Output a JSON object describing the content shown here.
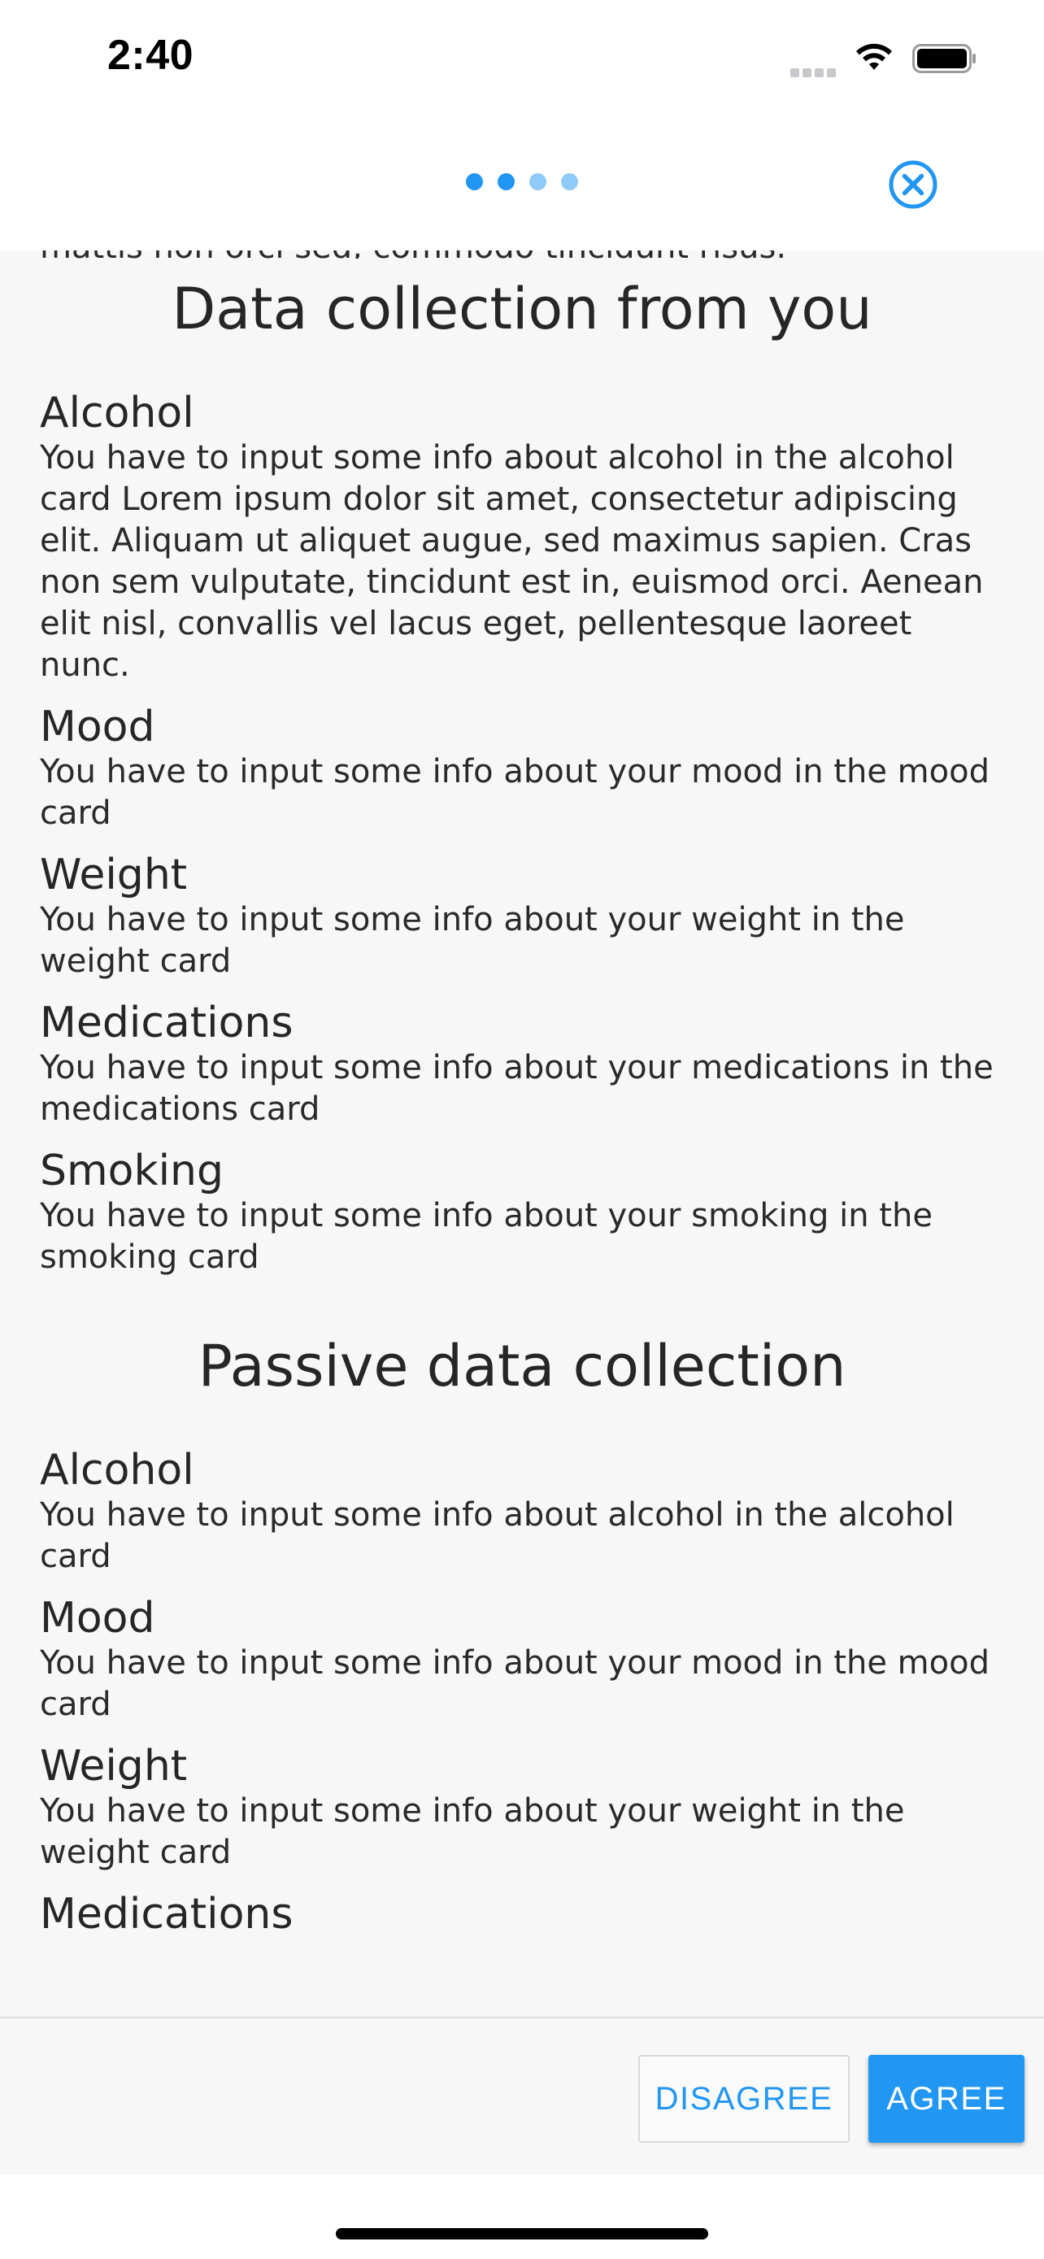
{
  "status_bar": {
    "time": "2:40"
  },
  "pager": {
    "dots": [
      {
        "state": "active",
        "color": "#2196f3"
      },
      {
        "state": "active",
        "color": "#2196f3"
      },
      {
        "state": "inactive",
        "color": "#90caf9"
      },
      {
        "state": "inactive",
        "color": "#90caf9"
      }
    ],
    "close_icon": "close-circle-icon"
  },
  "content": {
    "clipped_text": "mattis non orci sed, commodo tincidunt risus.",
    "sections": [
      {
        "title": "Data collection from you",
        "items": [
          {
            "title": "Alcohol",
            "description": "You have to input some info about alcohol in the alcohol card  Lorem ipsum dolor sit amet, consectetur adipiscing elit. Aliquam ut aliquet augue, sed maximus sapien. Cras non sem vulputate, tincidunt est in, euismod orci. Aenean elit nisl, convallis vel lacus eget, pellentesque laoreet nunc."
          },
          {
            "title": "Mood",
            "description": "You have to input some info about your mood in the mood card"
          },
          {
            "title": "Weight",
            "description": "You have to input some info about your weight in the weight card"
          },
          {
            "title": "Medications",
            "description": "You have to input some info about your medications in the medications card"
          },
          {
            "title": "Smoking",
            "description": "You have to input some info about your smoking in the smoking card"
          }
        ]
      },
      {
        "title": "Passive data collection",
        "items": [
          {
            "title": "Alcohol",
            "description": "You have to input some info about alcohol in the alcohol card"
          },
          {
            "title": "Mood",
            "description": "You have to input some info about your mood in the mood card"
          },
          {
            "title": "Weight",
            "description": "You have to input some info about your weight in the weight card"
          },
          {
            "title": "Medications",
            "description": ""
          }
        ]
      }
    ]
  },
  "actions": {
    "disagree_label": "DISAGREE",
    "agree_label": "AGREE"
  },
  "colors": {
    "accent": "#2196f3",
    "accent_light": "#90caf9",
    "content_bg": "#f7f7f7"
  }
}
